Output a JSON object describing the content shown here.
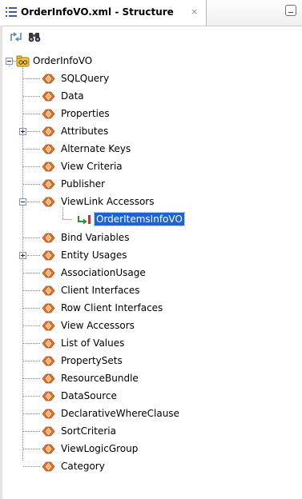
{
  "tab": {
    "title": "OrderInfoVO.xml - Structure",
    "close_glyph": "×",
    "icon": "structure-list-icon"
  },
  "toolbar": {
    "buttons": [
      "sync-with-editor-icon",
      "find-binoculars-icon"
    ]
  },
  "tree": {
    "root": {
      "label": "OrderInfoVO",
      "icon": "view-object-icon",
      "expanded": true
    },
    "children": [
      {
        "label": "SQLQuery",
        "icon": "xml-element-icon"
      },
      {
        "label": "Data",
        "icon": "xml-element-icon"
      },
      {
        "label": "Properties",
        "icon": "xml-element-icon"
      },
      {
        "label": "Attributes",
        "icon": "xml-element-icon",
        "expandable": true,
        "expanded": false
      },
      {
        "label": "Alternate Keys",
        "icon": "xml-element-icon"
      },
      {
        "label": "View Criteria",
        "icon": "xml-element-icon"
      },
      {
        "label": "Publisher",
        "icon": "xml-element-icon"
      },
      {
        "label": "ViewLink Accessors",
        "icon": "xml-element-icon",
        "expandable": true,
        "expanded": true,
        "children": [
          {
            "label": "OrderItemsInfoVO",
            "icon": "view-link-icon",
            "selected": true
          }
        ]
      },
      {
        "label": "Bind Variables",
        "icon": "xml-element-icon"
      },
      {
        "label": "Entity Usages",
        "icon": "xml-element-icon",
        "expandable": true,
        "expanded": false
      },
      {
        "label": "AssociationUsage",
        "icon": "xml-element-icon"
      },
      {
        "label": "Client Interfaces",
        "icon": "xml-element-icon"
      },
      {
        "label": "Row Client Interfaces",
        "icon": "xml-element-icon"
      },
      {
        "label": "View Accessors",
        "icon": "xml-element-icon"
      },
      {
        "label": "List of Values",
        "icon": "xml-element-icon"
      },
      {
        "label": "PropertySets",
        "icon": "xml-element-icon"
      },
      {
        "label": "ResourceBundle",
        "icon": "xml-element-icon"
      },
      {
        "label": "DataSource",
        "icon": "xml-element-icon"
      },
      {
        "label": "DeclarativeWhereClause",
        "icon": "xml-element-icon"
      },
      {
        "label": "SortCriteria",
        "icon": "xml-element-icon"
      },
      {
        "label": "ViewLogicGroup",
        "icon": "xml-element-icon"
      },
      {
        "label": "Category",
        "icon": "xml-element-icon"
      }
    ]
  },
  "colors": {
    "selection": "#1f63d1",
    "element_icon_orange": "#e8742a",
    "view_object_yellow": "#f2c53d"
  }
}
